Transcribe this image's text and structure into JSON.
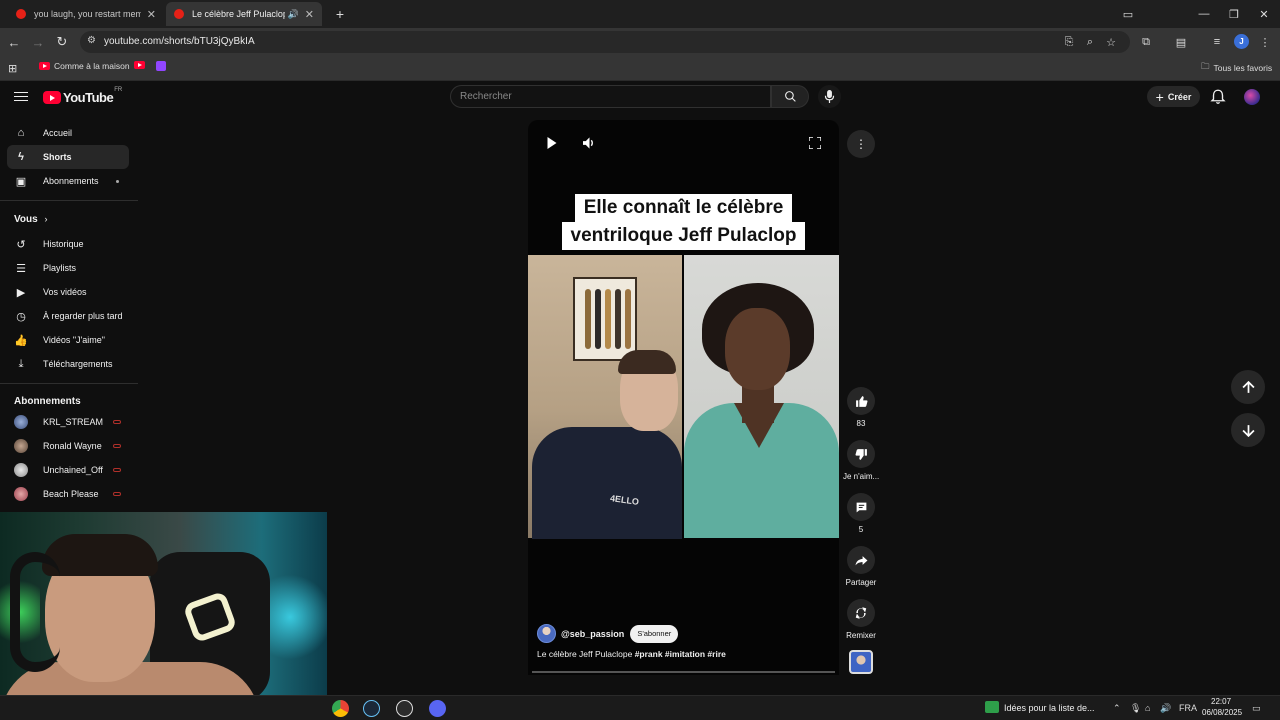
{
  "browser": {
    "tabs": [
      {
        "title": "you laugh, you restart meme -"
      },
      {
        "title": "Le célèbre Jeff Pulaclope #p"
      }
    ],
    "url": "youtube.com/shorts/bTU3jQyBkIA",
    "bookmarks": [
      {
        "label": "Comme à la maison",
        "icon": "youtube-icon"
      },
      {
        "label": "",
        "icon": "youtube-icon"
      },
      {
        "label": "",
        "icon": "twitch-icon"
      }
    ],
    "all_bookmarks_label": "Tous les favoris",
    "profile_initial": "J"
  },
  "youtube": {
    "logo_text": "YouTube",
    "country_code": "FR",
    "search_placeholder": "Rechercher",
    "create_label": "Créer"
  },
  "sidebar": {
    "main": [
      {
        "label": "Accueil",
        "icon": "home-icon"
      },
      {
        "label": "Shorts",
        "icon": "shorts-icon",
        "active": true
      },
      {
        "label": "Abonnements",
        "icon": "subscriptions-icon"
      }
    ],
    "you_heading": "Vous",
    "you": [
      {
        "label": "Historique",
        "icon": "history-icon"
      },
      {
        "label": "Playlists",
        "icon": "playlists-icon"
      },
      {
        "label": "Vos vidéos",
        "icon": "your-videos-icon"
      },
      {
        "label": "À regarder plus tard",
        "icon": "watch-later-icon"
      },
      {
        "label": "Vidéos \"J'aime\"",
        "icon": "liked-videos-icon"
      },
      {
        "label": "Téléchargements",
        "icon": "downloads-icon"
      }
    ],
    "subs_heading": "Abonnements",
    "subscriptions": [
      {
        "label": "KRL_STREAM"
      },
      {
        "label": "Ronald Wayne"
      },
      {
        "label": "Unchained_Off"
      },
      {
        "label": "Beach Please"
      }
    ]
  },
  "short": {
    "caption_line1": "Elle connaît le célèbre",
    "caption_line2": "ventriloque Jeff Pulaclop",
    "shirt_text": "4ELLO",
    "channel": "@seb_passion",
    "subscribe_label": "S'abonner",
    "description": "Le célèbre Jeff Pulaclope",
    "hashtags": "#prank #imitation #rire",
    "progress_fraction": 0.0
  },
  "actions": {
    "likes": "83",
    "dislike_label": "Je n'aim...",
    "comments": "5",
    "share_label": "Partager",
    "remix_label": "Remixer"
  },
  "taskbar": {
    "widget_text": "Idées pour la liste de...",
    "language": "FRA",
    "time": "22:07",
    "date": "06/08/2025"
  }
}
